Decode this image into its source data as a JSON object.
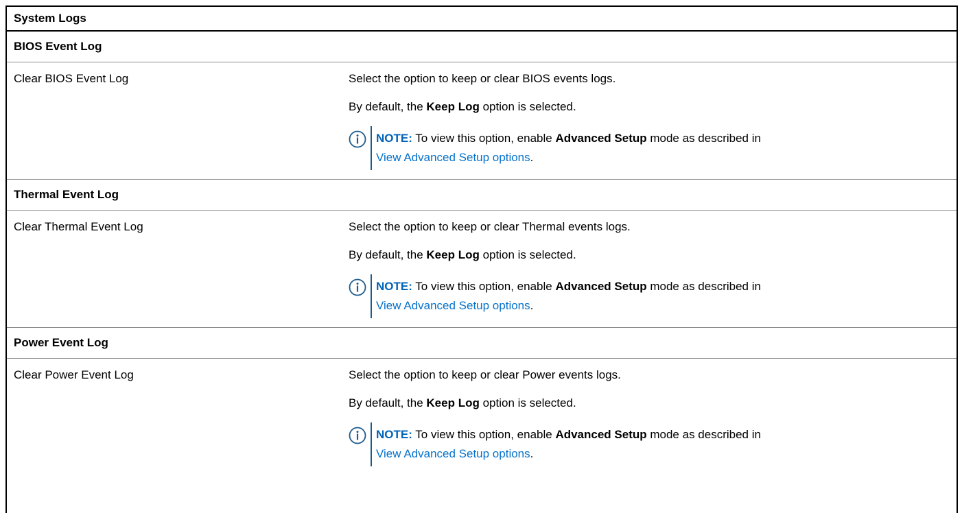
{
  "table": {
    "title": "System Logs",
    "sections": [
      {
        "heading": "BIOS Event Log",
        "setting": "Clear BIOS Event Log",
        "desc_line1": "Select the option to keep or clear BIOS events logs.",
        "desc_default_prefix": "By default, the ",
        "desc_default_bold": "Keep Log",
        "desc_default_suffix": " option is selected.",
        "note_label": "NOTE:",
        "note_text_prefix": " To view this option, enable ",
        "note_bold": "Advanced Setup",
        "note_text_suffix": " mode as described in",
        "note_link": "View Advanced Setup options",
        "note_end": "."
      },
      {
        "heading": "Thermal Event Log",
        "setting": "Clear Thermal Event Log",
        "desc_line1": "Select the option to keep or clear Thermal events logs.",
        "desc_default_prefix": "By default, the ",
        "desc_default_bold": "Keep Log",
        "desc_default_suffix": " option is selected.",
        "note_label": "NOTE:",
        "note_text_prefix": " To view this option, enable ",
        "note_bold": "Advanced Setup",
        "note_text_suffix": " mode as described in",
        "note_link": "View Advanced Setup options",
        "note_end": "."
      },
      {
        "heading": "Power Event Log",
        "setting": "Clear Power Event Log",
        "desc_line1": "Select the option to keep or clear Power events logs.",
        "desc_default_prefix": "By default, the ",
        "desc_default_bold": "Keep Log",
        "desc_default_suffix": " option is selected.",
        "note_label": "NOTE:",
        "note_text_prefix": " To view this option, enable ",
        "note_bold": "Advanced Setup",
        "note_text_suffix": " mode as described in",
        "note_link": "View Advanced Setup options",
        "note_end": "."
      }
    ]
  },
  "colors": {
    "note_label": "#0063b8",
    "link": "#0672cb",
    "note_bar": "#1e5b8c",
    "icon": "#1e5b8c"
  },
  "icons": {
    "note": "info-circle-icon"
  }
}
